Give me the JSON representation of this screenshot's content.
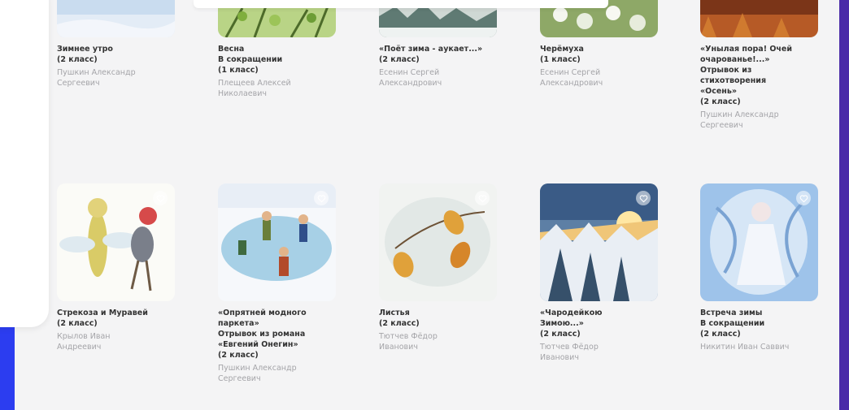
{
  "row1": [
    {
      "title": "Зимнее утро\n(2 класс)",
      "author": "Пушкин Александр\nСергеевич",
      "thumb": "winter-morning"
    },
    {
      "title": "Весна\nВ сокращении\n(1 класс)",
      "author": "Плещеев Алексей\nНиколаевич",
      "thumb": "spring"
    },
    {
      "title": "«Поёт зима - аукает...»\n(2 класс)",
      "author": "Есенин Сергей\nАлександрович",
      "thumb": "winter-sings"
    },
    {
      "title": "Черёмуха\n(1 класс)",
      "author": "Есенин Сергей\nАлександрович",
      "thumb": "bird-cherry"
    },
    {
      "title": "«Унылая пора! Очей\nочарованье!...»\nОтрывок из\nстихотворения\n«Осень»\n(2 класс)",
      "author": "Пушкин Александр\nСергеевич",
      "thumb": "autumn"
    }
  ],
  "row2": [
    {
      "title": "Стрекоза и Муравей\n(2 класс)",
      "author": "Крылов Иван\nАндреевич",
      "thumb": "dragonfly-ant"
    },
    {
      "title": "«Опрятней модного\nпаркета»\nОтрывок из романа\n«Евгений Онегин»\n(2 класс)",
      "author": "Пушкин Александр\nСергеевич",
      "thumb": "skating"
    },
    {
      "title": "Листья\n(2 класс)",
      "author": "Тютчев Фёдор\nИванович",
      "thumb": "leaves"
    },
    {
      "title": "«Чародейкою\nЗимою...»\n(2 класс)",
      "author": "Тютчев Фёдор\nИванович",
      "thumb": "enchantress-winter"
    },
    {
      "title": "Встреча зимы\nВ сокращении\n(2 класс)",
      "author": "Никитин Иван Саввич",
      "thumb": "winter-meeting"
    }
  ]
}
